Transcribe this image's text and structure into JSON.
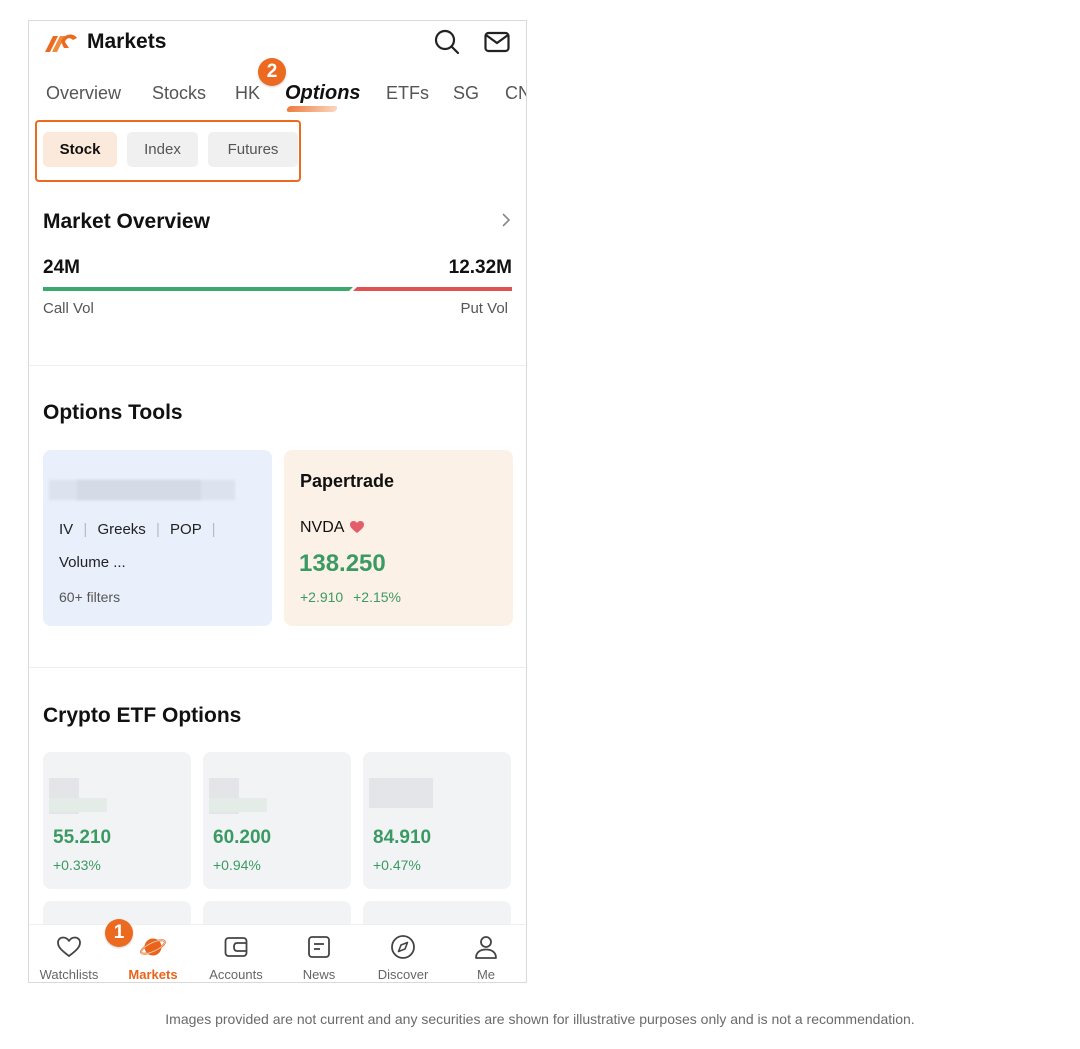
{
  "header": {
    "title": "Markets",
    "icons": [
      "logo-icon",
      "search-icon",
      "mail-icon"
    ]
  },
  "tabs": [
    {
      "label": "Overview",
      "active": false
    },
    {
      "label": "Stocks",
      "active": false
    },
    {
      "label": "HK",
      "active": false
    },
    {
      "label": "Options",
      "active": true
    },
    {
      "label": "ETFs",
      "active": false
    },
    {
      "label": "SG",
      "active": false
    },
    {
      "label": "CN",
      "active": false
    }
  ],
  "segments": [
    {
      "label": "Stock",
      "active": true
    },
    {
      "label": "Index",
      "active": false
    },
    {
      "label": "Futures",
      "active": false
    }
  ],
  "callouts": {
    "one": "1",
    "two": "2"
  },
  "market_overview": {
    "title": "Market Overview",
    "call_vol_value": "24M",
    "put_vol_value": "12.32M",
    "call_vol_label": "Call Vol",
    "put_vol_label": "Put Vol",
    "call_share": 0.661
  },
  "options_tools": {
    "title": "Options Tools",
    "screener": {
      "line1_items": [
        "IV",
        "Greeks",
        "POP"
      ],
      "line2": "Volume ...",
      "filters": "60+ filters"
    },
    "papertrade": {
      "title": "Papertrade",
      "symbol": "NVDA",
      "price": "138.250",
      "change": "+2.910",
      "change_pct": "+2.15%"
    }
  },
  "crypto_etf": {
    "title": "Crypto ETF Options",
    "cards": [
      {
        "price": "55.210",
        "change": "+0.33%"
      },
      {
        "price": "60.200",
        "change": "+0.94%"
      },
      {
        "price": "84.910",
        "change": "+0.47%"
      }
    ]
  },
  "bottom_nav": [
    {
      "label": "Watchlists",
      "icon": "heart-icon",
      "active": false
    },
    {
      "label": "Markets",
      "icon": "planet-icon",
      "active": true
    },
    {
      "label": "Accounts",
      "icon": "wallet-icon",
      "active": false
    },
    {
      "label": "News",
      "icon": "news-icon",
      "active": false
    },
    {
      "label": "Discover",
      "icon": "compass-icon",
      "active": false
    },
    {
      "label": "Me",
      "icon": "user-icon",
      "active": false
    }
  ],
  "colors": {
    "accent": "#ec6a1f",
    "up_green": "#3b9a63",
    "put_red": "#e05250",
    "call_green": "#3da86b"
  },
  "disclaimer": "Images provided are not current and any securities are shown for illustrative purposes only and is not a recommendation."
}
